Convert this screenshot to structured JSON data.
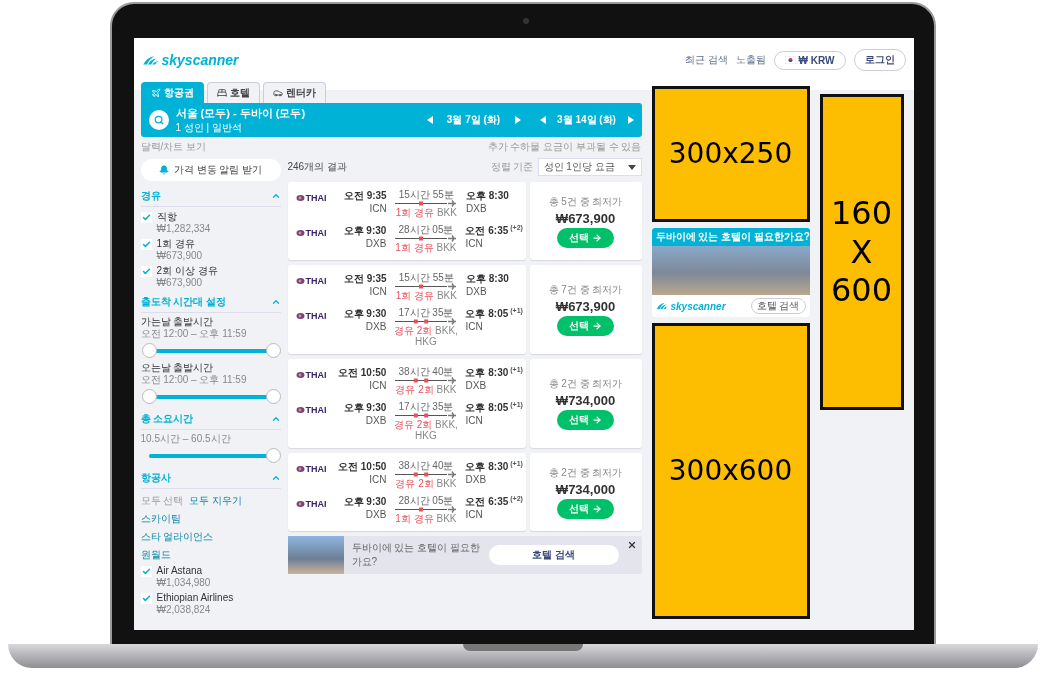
{
  "header": {
    "logo": "skyscanner",
    "links": [
      "최근 검색",
      "노출됨"
    ],
    "currency": "₩ KRW",
    "login": "로그인"
  },
  "tabs": [
    {
      "label": "항공권",
      "selected": true
    },
    {
      "label": "호텔",
      "selected": false
    },
    {
      "label": "렌터카",
      "selected": false
    }
  ],
  "search": {
    "route": "서울 (모두) - 두바이 (모두)",
    "details": "1 성인  |  일반석",
    "dates": [
      "3월 7일 (화)",
      "3월 14일 (화)"
    ]
  },
  "calendar_link": "달력/차트 보기",
  "fee_note": "추가 수하물 요금이 부과될 수 있음",
  "alert_button": "가격 변동 알림 받기",
  "sidebar": {
    "sections": [
      {
        "title": "경유",
        "expanded": true,
        "items": [
          {
            "kind": "checkbox",
            "label": "직항",
            "price": "₩1,282,334",
            "checked": true
          },
          {
            "kind": "checkbox",
            "label": "1회 경유",
            "price": "₩673,900",
            "checked": true
          },
          {
            "kind": "checkbox",
            "label": "2회 이상 경유",
            "price": "₩673,900",
            "checked": true
          }
        ]
      },
      {
        "title": "출도착 시간대 설정",
        "expanded": true,
        "items": [
          {
            "kind": "range",
            "label": "가는날 출발시간",
            "range": "오전 12:00 – 오후 11:59",
            "level": 1
          },
          {
            "kind": "range",
            "label": "오는날 출발시간",
            "range": "오전 12:00 – 오후 11:59",
            "level": 1
          }
        ]
      },
      {
        "title": "총 소요시간",
        "expanded": true,
        "items": [
          {
            "kind": "slider",
            "range": "10.5시간 – 60.5시간",
            "level": 1
          }
        ]
      },
      {
        "title": "항공사",
        "expanded": true,
        "items": [
          {
            "kind": "actions",
            "links": [
              {
                "label": "모두 선택",
                "disabled": true
              },
              {
                "label": "모두 지우기",
                "disabled": false
              }
            ]
          },
          {
            "kind": "link",
            "label": "스카이팀"
          },
          {
            "kind": "link",
            "label": "스타 얼라이언스"
          },
          {
            "kind": "link",
            "label": "원월드"
          },
          {
            "kind": "checkbox",
            "label": "Air Astana",
            "price": "₩1,034,980",
            "checked": true
          },
          {
            "kind": "checkbox",
            "label": "Ethiopian Airlines",
            "price": "₩2,038,824",
            "checked": true
          }
        ]
      }
    ]
  },
  "results": {
    "count": "246개의 결과",
    "sort_label": "정렬 기준",
    "sort_value": "성인 1인당 요금",
    "flights": [
      {
        "legs": [
          {
            "airline": "THAI",
            "depart": "오전 9:35",
            "from": "ICN",
            "duration": "15시간 55분",
            "kind": "one_stop",
            "stops": "1회 경유",
            "via": "BKK",
            "arrive": "오후 8:30",
            "to": "DXB"
          },
          {
            "airline": "THAI",
            "depart": "오후 9:30",
            "from": "DXB",
            "duration": "28시간 05분",
            "kind": "one_stop",
            "stops": "1회 경유",
            "via": "BKK",
            "arrive": "오전 6:35",
            "day_offset": "(+2)",
            "to": "ICN"
          }
        ],
        "offer": "총 5건 중 최저가",
        "price": "₩673,900",
        "button": "선택"
      },
      {
        "legs": [
          {
            "airline": "THAI",
            "depart": "오전 9:35",
            "from": "ICN",
            "duration": "15시간 55분",
            "kind": "one_stop",
            "stops": "1회 경유",
            "via": "BKK",
            "arrive": "오후 8:30",
            "to": "DXB"
          },
          {
            "airline": "THAI",
            "depart": "오후 9:30",
            "from": "DXB",
            "duration": "17시간 35분",
            "kind": "two_stops",
            "stops": "경유 2회",
            "via": "BKK, HKG",
            "arrive": "오후 8:05",
            "day_offset": "(+1)",
            "to": "ICN"
          }
        ],
        "offer": "총 7건 중 최저가",
        "price": "₩673,900",
        "button": "선택"
      },
      {
        "legs": [
          {
            "airline": "THAI",
            "depart": "오전 10:50",
            "from": "ICN",
            "duration": "38시간 40분",
            "kind": "two_stops",
            "stops": "경유 2회",
            "via": "BKK",
            "arrive": "오후 8:30",
            "day_offset": "(+1)",
            "to": "DXB"
          },
          {
            "airline": "THAI",
            "depart": "오후 9:30",
            "from": "DXB",
            "duration": "17시간 35분",
            "kind": "two_stops",
            "stops": "경유 2회",
            "via": "BKK, HKG",
            "arrive": "오후 8:05",
            "day_offset": "(+1)",
            "to": "ICN"
          }
        ],
        "offer": "총 2건 중 최저가",
        "price": "₩734,000",
        "button": "선택"
      },
      {
        "legs": [
          {
            "airline": "THAI",
            "depart": "오전 10:50",
            "from": "ICN",
            "duration": "38시간 40분",
            "kind": "two_stops",
            "stops": "경유 2회",
            "via": "BKK",
            "arrive": "오후 8:30",
            "day_offset": "(+1)",
            "to": "DXB"
          },
          {
            "airline": "THAI",
            "depart": "오후 9:30",
            "from": "DXB",
            "duration": "28시간 05분",
            "kind": "one_stop",
            "stops": "1회 경유",
            "via": "BKK",
            "arrive": "오전 6:35",
            "day_offset": "(+2)",
            "to": "ICN"
          }
        ],
        "offer": "총 2건 중 최저가",
        "price": "₩734,000",
        "button": "선택"
      }
    ],
    "hotel_banner": {
      "text": "두바이에 있는 호텔이 필요한가요?",
      "button": "호텔 검색"
    }
  },
  "ads": {
    "top": "300x250",
    "hotel_ad": {
      "title": "두바이에 있는 호텔이 필요한가요?",
      "logo": "skyscanner",
      "button": "호텔 검색"
    },
    "bottom": "300x600",
    "skyscraper": "160 X 600"
  }
}
